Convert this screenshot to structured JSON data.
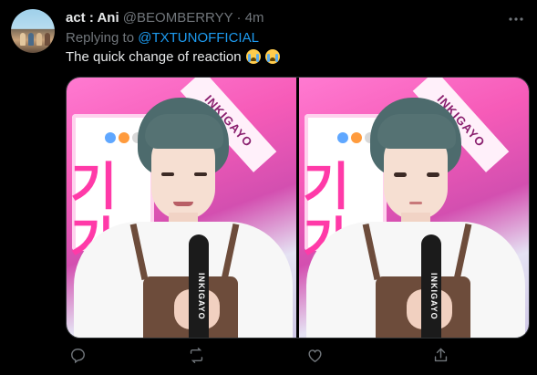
{
  "tweet": {
    "author_name": "act : Ani",
    "author_handle": "@BEOMBERRYY",
    "separator": "·",
    "time": "4m",
    "reply_prefix": "Replying to ",
    "reply_mention": "@TXTUNOFFICIAL",
    "text": "The quick change of reaction",
    "emojis": [
      "loudly-crying-face",
      "loudly-crying-face"
    ]
  },
  "media": {
    "images": [
      {
        "subject": "person-smiling",
        "mic_text": "INKIGAYO",
        "banner_text": "INKIGAYO"
      },
      {
        "subject": "person-neutral",
        "mic_text": "INKIGAYO",
        "banner_text": "INKIGAYO"
      }
    ]
  },
  "actions": [
    "reply-icon",
    "retweet-icon",
    "like-icon",
    "share-icon"
  ],
  "colors": {
    "background": "#000000",
    "text": "#e7e9ea",
    "muted": "#71767b",
    "link": "#1d9bf0",
    "border": "#2f3336"
  }
}
